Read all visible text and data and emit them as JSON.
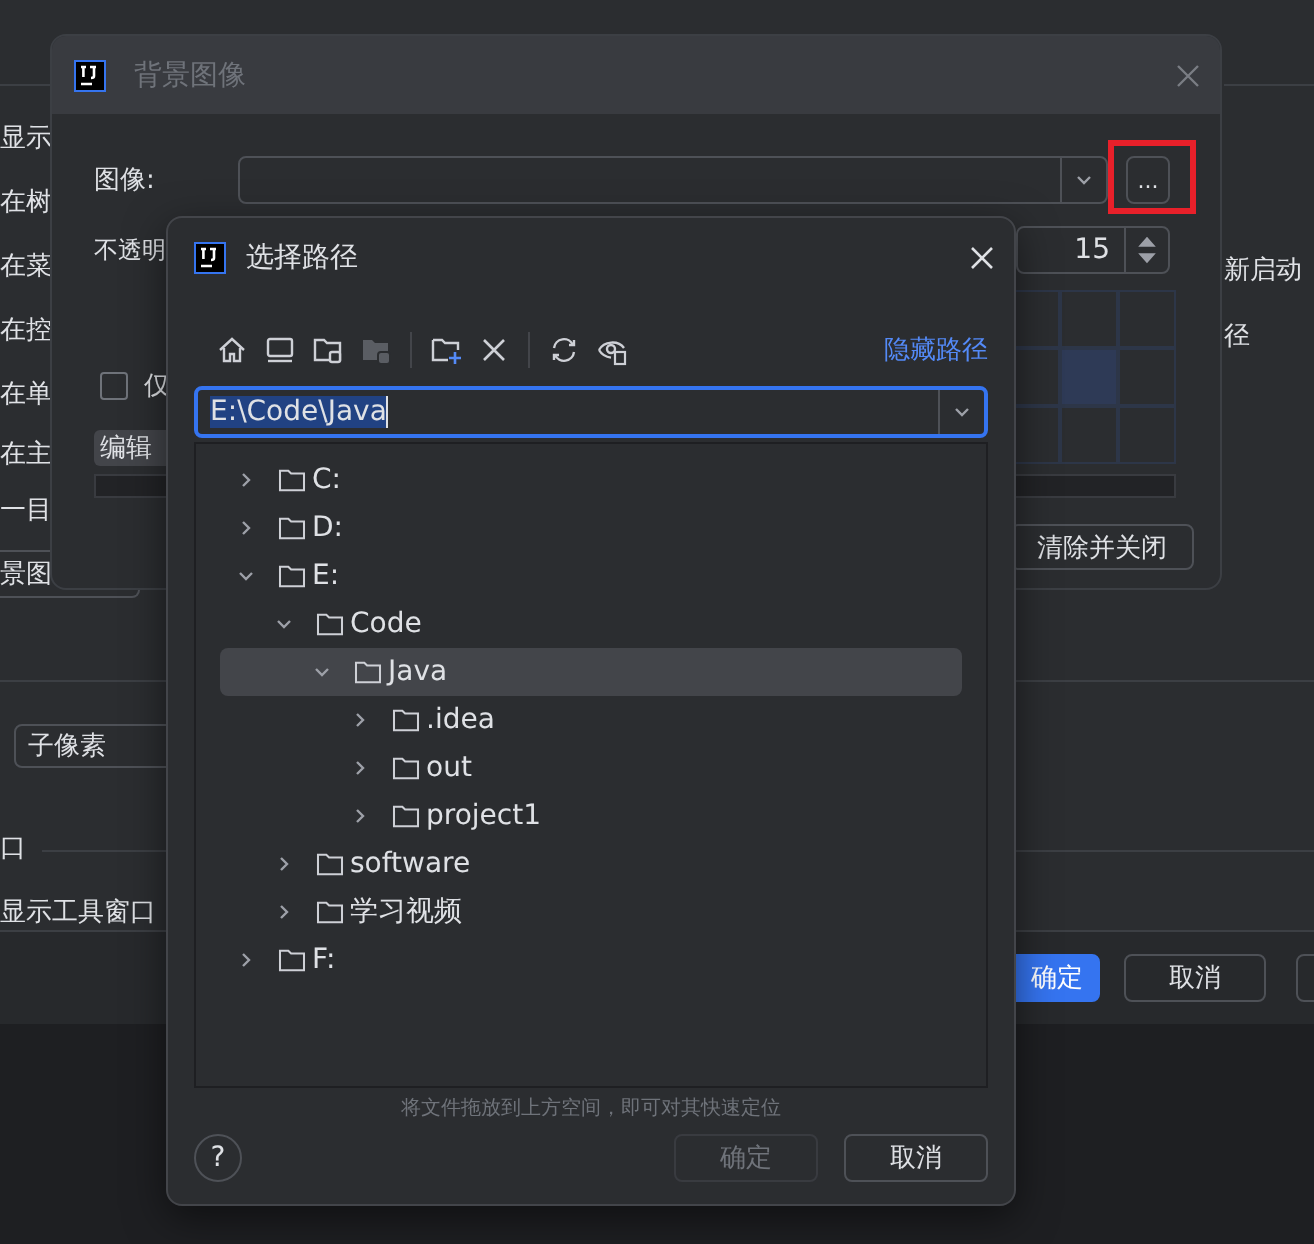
{
  "settings_panel": {
    "left_labels": [
      "显示",
      "在树",
      "在菜",
      "在控",
      "在单",
      "在主",
      "一目"
    ],
    "image_button": "景图",
    "right_labels": [
      "新启动",
      "径"
    ],
    "antialias_dropdown": "子像素",
    "section_heading": "口",
    "toolwindow_option": "显示工具窗口",
    "buttons": [
      {
        "label": "确定",
        "primary": true
      },
      {
        "label": "取消",
        "primary": false
      }
    ]
  },
  "background_dialog": {
    "title": "背景图像",
    "image_label": "图像:",
    "browse_button": "...",
    "opacity_label": "不透明",
    "opacity_value": "15",
    "placement_grid": [
      {
        "selected": false
      },
      {
        "selected": false
      },
      {
        "selected": false
      },
      {
        "selected": false
      },
      {
        "selected": true
      },
      {
        "selected": false
      },
      {
        "selected": false
      },
      {
        "selected": false
      },
      {
        "selected": false
      }
    ],
    "checkbox": {
      "label": "仅",
      "checked": false
    },
    "edit_button": "编辑",
    "clear_button": "清除并关闭"
  },
  "path_dialog": {
    "title": "选择路径",
    "toolbar": [
      [
        {
          "kind": "home",
          "disabled": false
        },
        {
          "kind": "desktop",
          "disabled": false
        },
        {
          "kind": "project",
          "disabled": false
        },
        {
          "kind": "module",
          "disabled": true
        }
      ],
      [
        {
          "kind": "new-folder",
          "disabled": false
        },
        {
          "kind": "delete",
          "disabled": false
        }
      ],
      [
        {
          "kind": "refresh",
          "disabled": false
        },
        {
          "kind": "hidden",
          "disabled": false
        }
      ]
    ],
    "hide_path_link": "隐藏路径",
    "path_field": {
      "value": "E:\\Code\\Java",
      "text_selected": true
    },
    "tree": [
      {
        "label": "C:",
        "expanded": false,
        "selected": false
      },
      {
        "label": "D:",
        "expanded": false,
        "selected": false
      },
      {
        "label": "E:",
        "expanded": true,
        "selected": false,
        "children": [
          {
            "label": "Code",
            "expanded": true,
            "selected": false,
            "children": [
              {
                "label": "Java",
                "expanded": true,
                "selected": true,
                "children": [
                  {
                    "label": ".idea",
                    "expanded": false,
                    "selected": false
                  },
                  {
                    "label": "out",
                    "expanded": false,
                    "selected": false
                  },
                  {
                    "label": "project1",
                    "expanded": false,
                    "selected": false
                  }
                ]
              }
            ]
          },
          {
            "label": "software",
            "expanded": false,
            "selected": false
          },
          {
            "label": "学习视频",
            "expanded": false,
            "selected": false
          }
        ]
      },
      {
        "label": "F:",
        "expanded": false,
        "selected": false
      }
    ],
    "hint": "将文件拖放到上方空间，即可对其快速定位",
    "help_button": "?",
    "buttons": [
      {
        "label": "确定",
        "disabled": true
      },
      {
        "label": "取消",
        "disabled": false
      }
    ]
  }
}
